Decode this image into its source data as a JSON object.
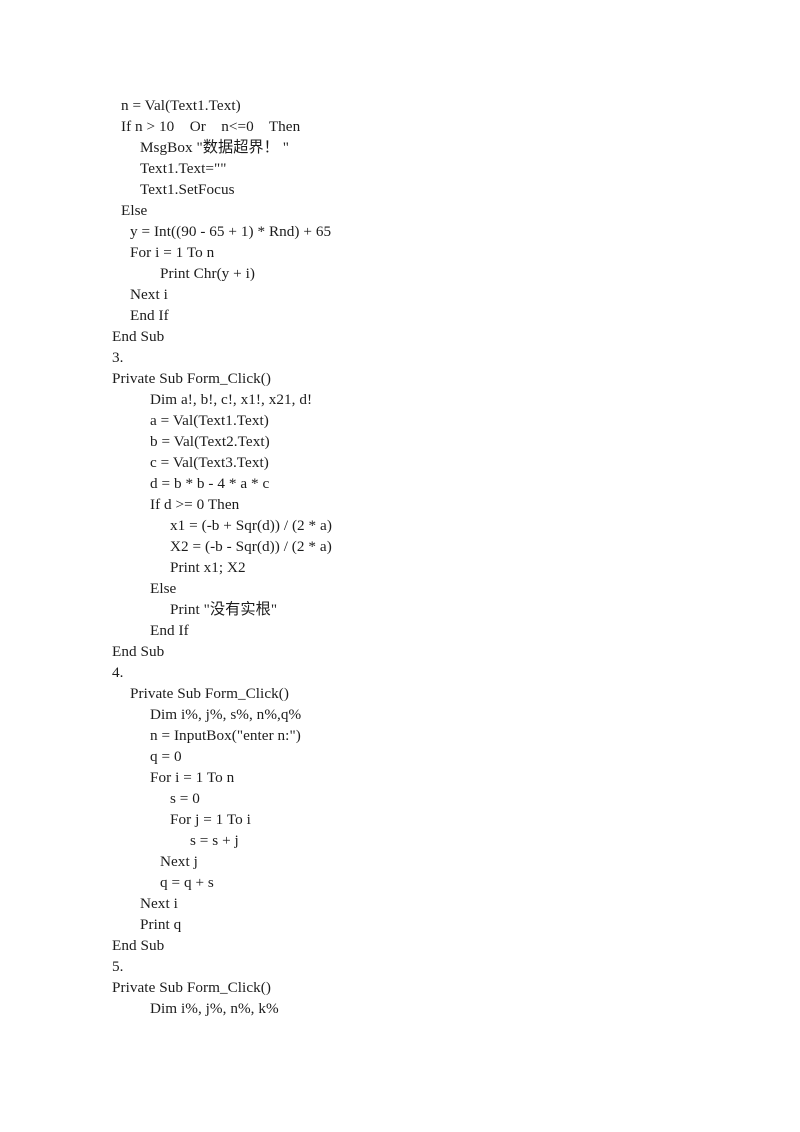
{
  "document": {
    "background_color": "#ffffff",
    "text_color": "#1c1c1c",
    "language": "Visual Basic"
  },
  "sections": [
    {
      "number": "",
      "lines": [
        {
          "indent": 1,
          "text": "n = Val(Text1.Text)"
        },
        {
          "indent": 1,
          "text": "If n > 10    Or    n<=0    Then"
        },
        {
          "indent": 3,
          "text": "MsgBox \"数据超界！ \""
        },
        {
          "indent": 3,
          "text": "Text1.Text=\"\""
        },
        {
          "indent": 3,
          "text": "Text1.SetFocus"
        },
        {
          "indent": 1,
          "text": "Else"
        },
        {
          "indent": 2,
          "text": "y = Int((90 - 65 + 1) * Rnd) + 65"
        },
        {
          "indent": 2,
          "text": "For i = 1 To n"
        },
        {
          "indent": 5,
          "text": "Print Chr(y + i)"
        },
        {
          "indent": 2,
          "text": "Next i"
        },
        {
          "indent": 2,
          "text": "End If"
        },
        {
          "indent": 0,
          "text": "End Sub"
        }
      ]
    },
    {
      "number": "3.",
      "lines": [
        {
          "indent": 0,
          "text": "Private Sub Form_Click()"
        },
        {
          "indent": 4,
          "text": "Dim a!, b!, c!, x1!, x21, d!"
        },
        {
          "indent": 4,
          "text": "a = Val(Text1.Text)"
        },
        {
          "indent": 4,
          "text": "b = Val(Text2.Text)"
        },
        {
          "indent": 4,
          "text": "c = Val(Text3.Text)"
        },
        {
          "indent": 4,
          "text": "d = b * b - 4 * a * c"
        },
        {
          "indent": 4,
          "text": "If d >= 0 Then"
        },
        {
          "indent": 6,
          "text": "x1 = (-b + Sqr(d)) / (2 * a)"
        },
        {
          "indent": 6,
          "text": "X2 = (-b - Sqr(d)) / (2 * a)"
        },
        {
          "indent": 6,
          "text": "Print x1; X2"
        },
        {
          "indent": 4,
          "text": "Else"
        },
        {
          "indent": 6,
          "text": "Print \"没有实根\""
        },
        {
          "indent": 4,
          "text": "End If"
        },
        {
          "indent": 0,
          "text": "End Sub"
        }
      ]
    },
    {
      "number": "4.",
      "lines": [
        {
          "indent": 2,
          "text": "Private Sub Form_Click()"
        },
        {
          "indent": 4,
          "text": "Dim i%, j%, s%, n%,q%"
        },
        {
          "indent": 4,
          "text": "n = InputBox(\"enter n:\")"
        },
        {
          "indent": 4,
          "text": "q = 0"
        },
        {
          "indent": 4,
          "text": "For i = 1 To n"
        },
        {
          "indent": 6,
          "text": "s = 0"
        },
        {
          "indent": 6,
          "text": "For j = 1 To i"
        },
        {
          "indent": 8,
          "text": "s = s + j"
        },
        {
          "indent": 5,
          "text": "Next j"
        },
        {
          "indent": 5,
          "text": "q = q + s"
        },
        {
          "indent": 3,
          "text": "Next i"
        },
        {
          "indent": 3,
          "text": "Print q"
        },
        {
          "indent": 0,
          "text": "End Sub"
        }
      ]
    },
    {
      "number": "5.",
      "lines": [
        {
          "indent": 0,
          "text": "Private Sub Form_Click()"
        },
        {
          "indent": 4,
          "text": "Dim i%, j%, n%, k%"
        }
      ]
    }
  ]
}
